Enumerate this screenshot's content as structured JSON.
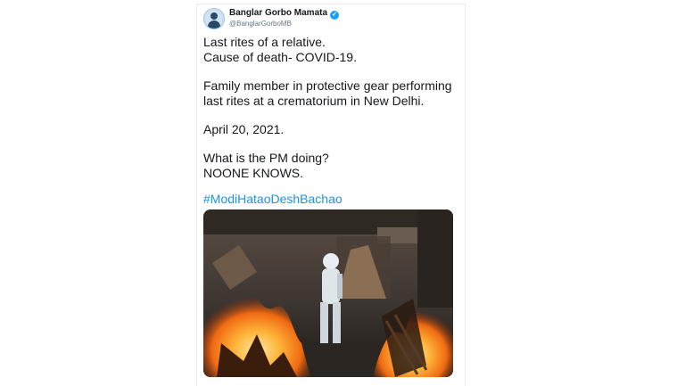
{
  "tweet": {
    "display_name": "Banglar Gorbo Mamata",
    "handle": "@BanglarGorboMB",
    "verified_glyph": "✓",
    "lines": [
      "Last rites of a relative.",
      "Cause of death- COVID-19.",
      "Family member in protective gear performing",
      "last rites at a crematorium in New Delhi.",
      "April 20, 2021.",
      "What is the PM doing?",
      "NOONE KNOWS."
    ],
    "hashtag": "#ModiHataoDeshBachao",
    "avatar_icon": "profile-avatar-icon",
    "verified_icon": "verified-badge-icon"
  },
  "colors": {
    "text": "#14171a",
    "handle": "#657786",
    "link": "#1b95e0",
    "verified": "#1da1f2"
  }
}
